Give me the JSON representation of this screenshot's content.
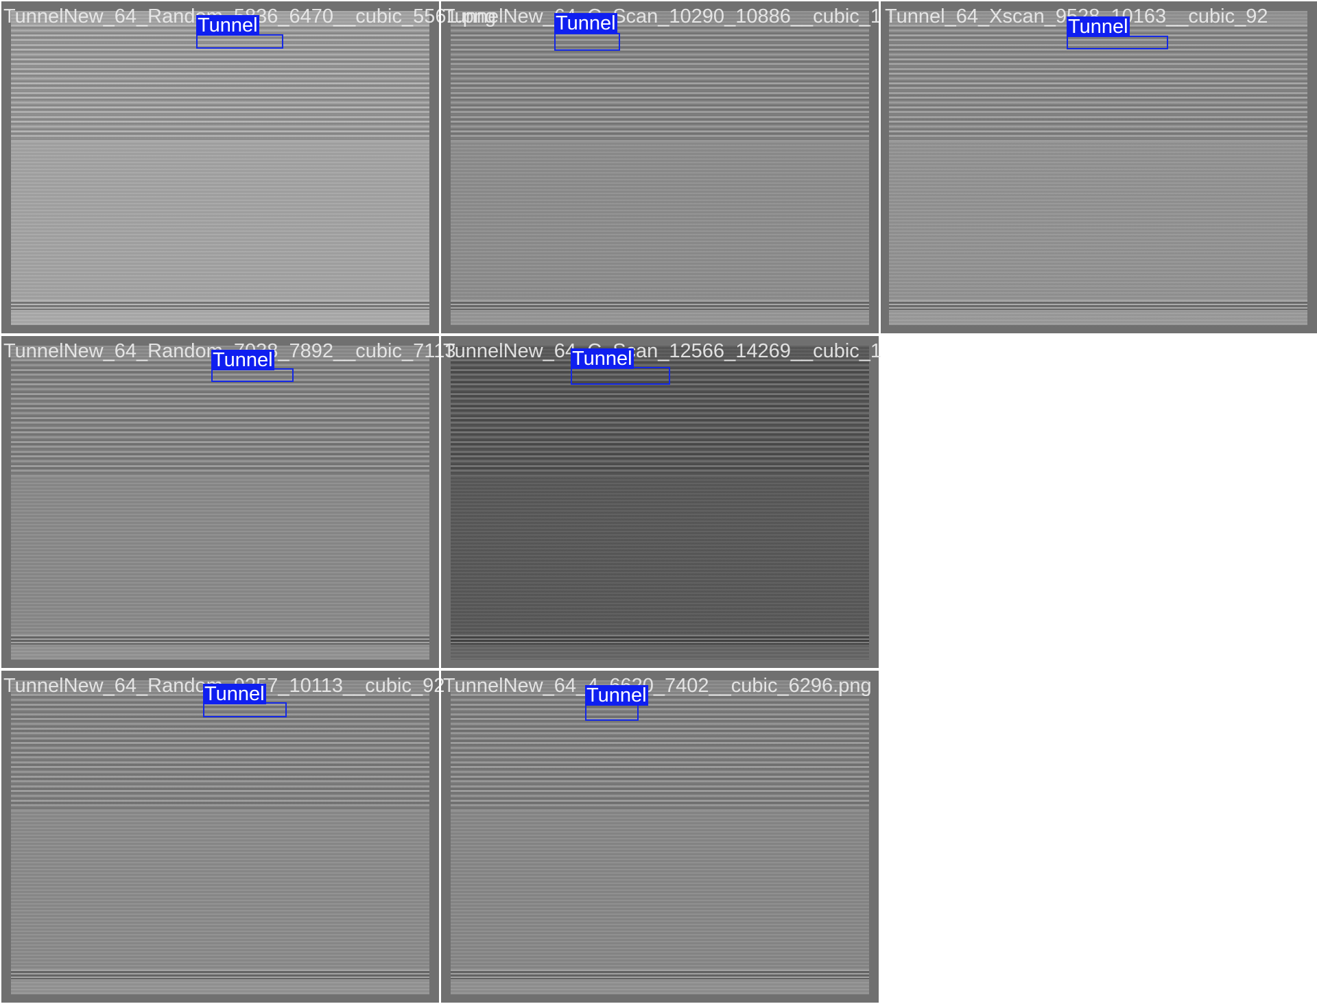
{
  "tiles": [
    {
      "name": "TunnelNew_64_Random_5836_6470__cubic_5561.png",
      "label": "Tunnel",
      "tone": "#a6a6a6"
    },
    {
      "name": "TunnelNew_64_C_Scan_10290_10886__cubic_1",
      "label": "Tunnel",
      "tone": "#8f8f8f"
    },
    {
      "name": "Tunnel_64_Xscan_9528_10163__cubic_92",
      "label": "Tunnel",
      "tone": "#959595"
    },
    {
      "name": "TunnelNew_64_Random_7038_7892__cubic_7113",
      "label": "Tunnel",
      "tone": "#8c8c8c"
    },
    {
      "name": "TunnelNew_64_C_Scan_12566_14269__cubic_1",
      "label": "Tunnel",
      "tone": "#5a5a5a"
    },
    {
      "name": "TunnelNew_64_Random_9357_10113__cubic_92",
      "label": "Tunnel",
      "tone": "#8d8d8d"
    },
    {
      "name": "TunnelNew_64_4_6620_7402__cubic_6296.png",
      "label": "Tunnel",
      "tone": "#8a8a8a"
    }
  ]
}
